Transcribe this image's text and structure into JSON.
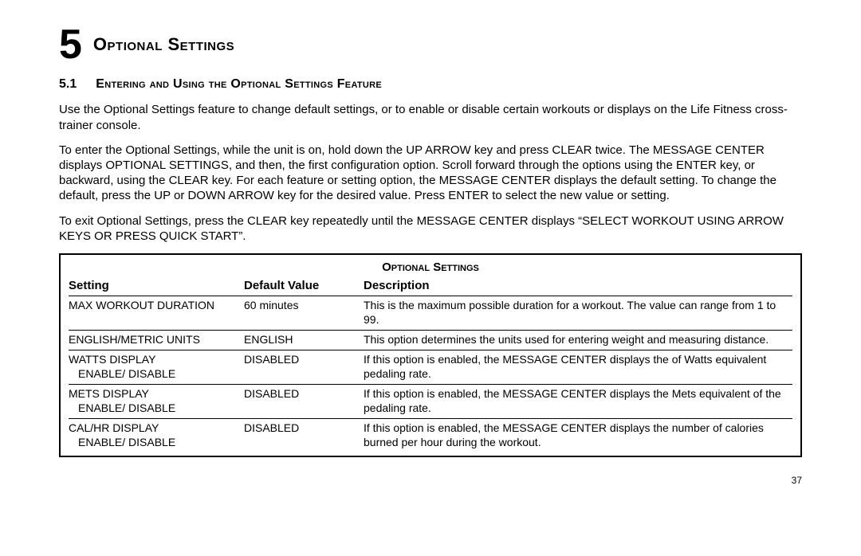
{
  "chapter": {
    "number": "5",
    "title": "Optional Settings"
  },
  "section": {
    "number": "5.1",
    "title": "Entering and Using the Optional Settings Feature"
  },
  "paragraphs": [
    "Use the Optional Settings feature to change default settings, or to enable or disable certain workouts or displays on the Life Fitness cross-trainer console.",
    "To enter the Optional Settings, while the unit is on, hold down the UP ARROW key and press CLEAR twice. The MESSAGE CENTER displays OPTIONAL SETTINGS, and then, the first configuration option. Scroll forward through the options using the ENTER key, or backward, using the  CLEAR key. For each feature or setting option, the MESSAGE CENTER displays the default setting. To change the default, press the UP or DOWN ARROW key for the desired value. Press ENTER to select the new value or setting.",
    "To exit Optional Settings, press the CLEAR key repeatedly until the MESSAGE CENTER displays “SELECT WORKOUT USING ARROW KEYS OR PRESS QUICK START”."
  ],
  "table": {
    "title": "Optional Settings",
    "headers": {
      "setting": "Setting",
      "default": "Default Value",
      "description": "Description"
    },
    "rows": [
      {
        "setting_line1": "MAX WORKOUT DURATION",
        "setting_line2": "",
        "default": "60 minutes",
        "description": "This is the maximum possible duration for a workout. The value can range from 1 to 99."
      },
      {
        "setting_line1": "ENGLISH/METRIC UNITS",
        "setting_line2": "",
        "default": "ENGLISH",
        "description": "This option determines the units used for entering weight and measuring distance."
      },
      {
        "setting_line1": "WATTS DISPLAY",
        "setting_line2": "ENABLE/ DISABLE",
        "default": "DISABLED",
        "description": "If this option is enabled, the MESSAGE CENTER displays the of Watts equivalent pedaling rate."
      },
      {
        "setting_line1": "METS DISPLAY",
        "setting_line2": "ENABLE/ DISABLE",
        "default": "DISABLED",
        "description": "If this option is enabled, the MESSAGE CENTER displays the Mets equivalent of the pedaling rate."
      },
      {
        "setting_line1": "CAL/HR DISPLAY",
        "setting_line2": "ENABLE/ DISABLE",
        "default": "DISABLED",
        "description": "If this option is enabled, the MESSAGE CENTER displays the number of calories burned per hour during the workout."
      }
    ]
  },
  "page_number": "37"
}
